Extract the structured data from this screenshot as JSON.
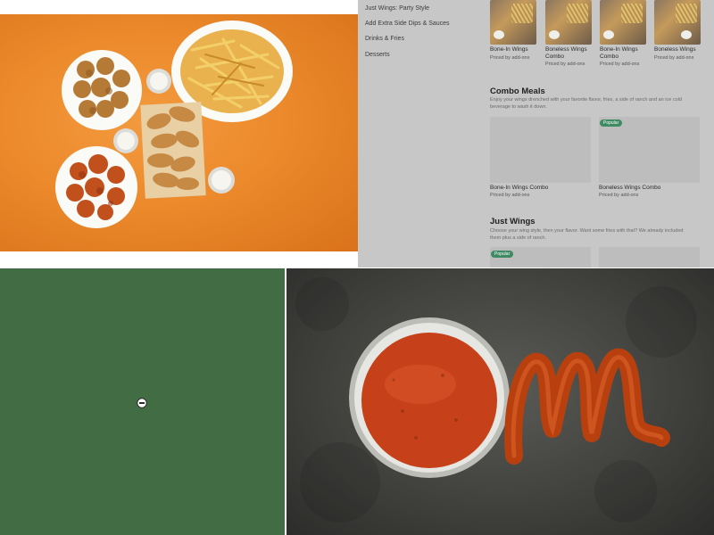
{
  "photos": {
    "wings_platter": "wings-platter-photo",
    "sauce_cup": "sauce-cup-photo"
  },
  "menu": {
    "nav": [
      {
        "label": "Just Wings: Party Style"
      },
      {
        "label": "Add Extra Side Dips & Sauces"
      },
      {
        "label": "Drinks & Fries"
      },
      {
        "label": "Desserts"
      }
    ],
    "top_items": [
      {
        "title": "Bone-In Wings",
        "price": "Priced by add-ons"
      },
      {
        "title": "Boneless Wings Combo",
        "price": "Priced by add-ons"
      },
      {
        "title": "Bone-In Wings Combo",
        "price": "Priced by add-ons"
      },
      {
        "title": "Boneless Wings",
        "price": "Priced by add-ons"
      }
    ],
    "combo": {
      "title": "Combo Meals",
      "desc": "Enjoy your wings drenched with your favorite flavor, fries, a side of ranch and an ice cold beverage to wash it down.",
      "items": [
        {
          "title": "Bone-In Wings Combo",
          "price": "Priced by add-ons"
        },
        {
          "title": "Boneless Wings Combo",
          "price": "Priced by add-ons",
          "badge": "Popular"
        }
      ]
    },
    "just_wings": {
      "title": "Just Wings",
      "desc": "Choose your wing style, then your flavor. Want some fries with that? We already included them plus a side of ranch.",
      "badge": "Popular"
    }
  },
  "green_panel": {
    "icon": "minus-circle-icon"
  },
  "colors": {
    "orange_bg": "#ec8a2c",
    "menu_overlay": "#c7c7c7",
    "green_panel": "#416c44",
    "badge_green": "#3d8a63",
    "sauce_red": "#c6401a"
  }
}
